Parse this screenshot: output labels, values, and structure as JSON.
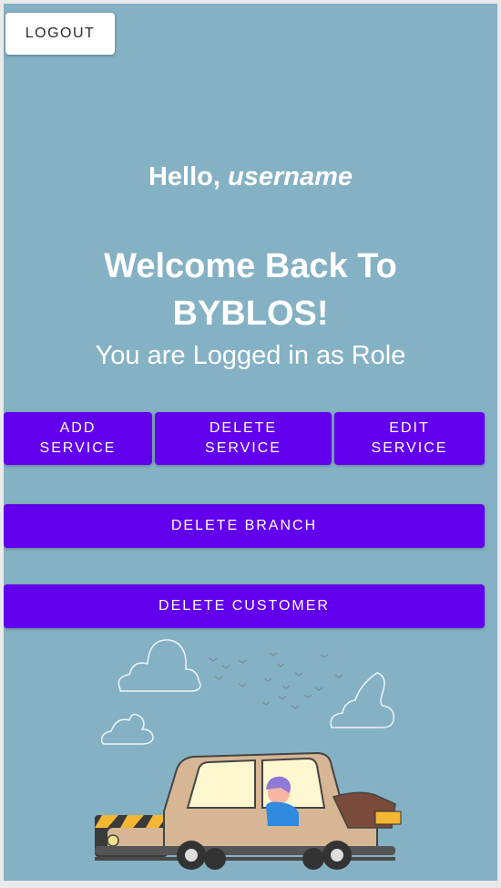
{
  "header": {
    "logout_label": "LOGOUT"
  },
  "greeting": {
    "prefix": "Hello, ",
    "username": "username"
  },
  "welcome": {
    "line1": "Welcome Back To",
    "line2": "BYBLOS!"
  },
  "role_text": "You are Logged in as Role",
  "actions": {
    "add_service": "ADD\nSERVICE",
    "delete_service": "DELETE\nSERVICE",
    "edit_service": "EDIT\nSERVICE",
    "delete_branch": "DELETE BRANCH",
    "delete_customer": "DELETE CUSTOMER"
  },
  "colors": {
    "background": "#85b1c4",
    "primary_button": "#6200ee",
    "text": "#ffffff"
  },
  "illustration": "car-illustration"
}
